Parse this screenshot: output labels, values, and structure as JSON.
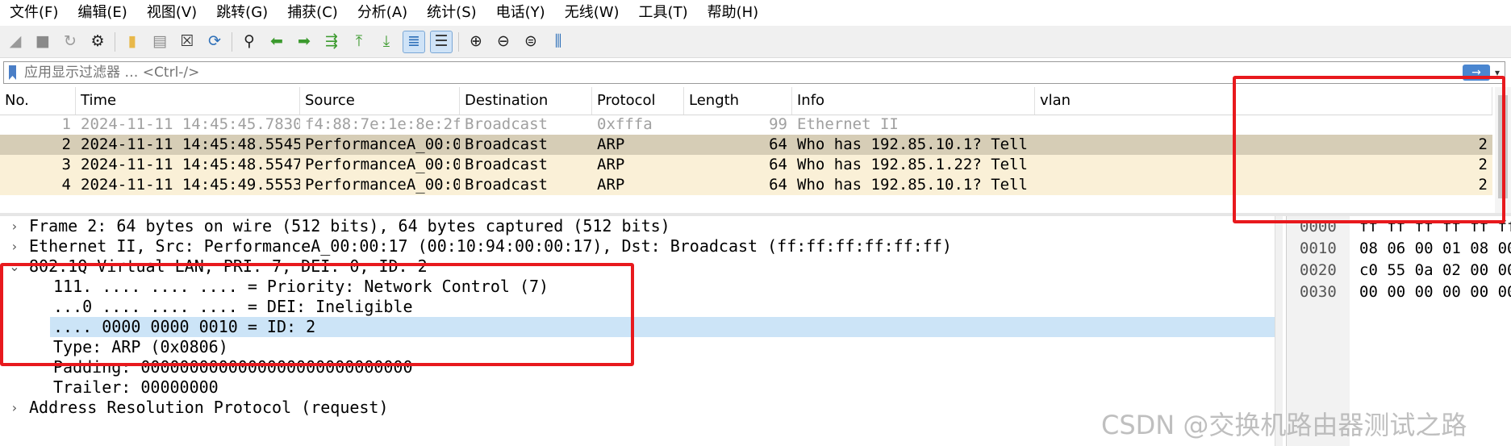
{
  "menu": [
    "文件(F)",
    "编辑(E)",
    "视图(V)",
    "跳转(G)",
    "捕获(C)",
    "分析(A)",
    "统计(S)",
    "电话(Y)",
    "无线(W)",
    "工具(T)",
    "帮助(H)"
  ],
  "toolbar": {
    "icons": [
      {
        "name": "shark-fin-start-icon",
        "glyph": "◢",
        "color": "#9a9a9a"
      },
      {
        "name": "stop-capture-icon",
        "glyph": "■",
        "color": "#8a8a8a"
      },
      {
        "name": "restart-capture-icon",
        "glyph": "↻",
        "color": "#9a9a9a"
      },
      {
        "name": "capture-options-icon",
        "glyph": "⚙",
        "color": "#222222"
      },
      {
        "sep": true
      },
      {
        "name": "open-file-icon",
        "glyph": "▮",
        "color": "#e8b84a"
      },
      {
        "name": "save-file-icon",
        "glyph": "▤",
        "color": "#8a8a8a"
      },
      {
        "name": "close-file-icon",
        "glyph": "☒",
        "color": "#333333"
      },
      {
        "name": "reload-file-icon",
        "glyph": "⟳",
        "color": "#2d6fb8"
      },
      {
        "sep": true
      },
      {
        "name": "find-packet-icon",
        "glyph": "⚲",
        "color": "#222222"
      },
      {
        "name": "go-back-icon",
        "glyph": "⬅",
        "color": "#3c9a2e"
      },
      {
        "name": "go-forward-icon",
        "glyph": "➡",
        "color": "#3c9a2e"
      },
      {
        "name": "go-to-packet-icon",
        "glyph": "⇶",
        "color": "#3c9a2e"
      },
      {
        "name": "go-first-icon",
        "glyph": "⤒",
        "color": "#3c9a2e"
      },
      {
        "name": "go-last-icon",
        "glyph": "⤓",
        "color": "#3c9a2e"
      },
      {
        "name": "auto-scroll-icon",
        "glyph": "≣",
        "color": "#2d6fb8",
        "selected": true
      },
      {
        "name": "colorize-icon",
        "glyph": "☰",
        "color": "#333333",
        "selected": true
      },
      {
        "sep": true
      },
      {
        "name": "zoom-in-icon",
        "glyph": "⊕",
        "color": "#222222"
      },
      {
        "name": "zoom-out-icon",
        "glyph": "⊖",
        "color": "#222222"
      },
      {
        "name": "zoom-normal-icon",
        "glyph": "⊜",
        "color": "#222222"
      },
      {
        "name": "resize-columns-icon",
        "glyph": "⫼",
        "color": "#2d6fb8"
      }
    ]
  },
  "filter": {
    "placeholder": "应用显示过滤器 … <Ctrl-/>",
    "apply_glyph": "→",
    "dropdown_glyph": "▾"
  },
  "packet_list": {
    "columns": [
      "No.",
      "Time",
      "Source",
      "Destination",
      "Protocol",
      "Length",
      "Info",
      "vlan"
    ],
    "rows": [
      {
        "no": "1",
        "time": "2024-11-11 14:45:45.78300…",
        "source": "f4:88:7e:1e:8e:2f",
        "destination": "Broadcast",
        "protocol": "0xfffa",
        "length": "99",
        "info": "Ethernet II",
        "vlan": "",
        "style": "dim"
      },
      {
        "no": "2",
        "time": "2024-11-11 14:45:48.55453…",
        "source": "PerformanceA_00:0…",
        "destination": "Broadcast",
        "protocol": "ARP",
        "length": "64",
        "info": "Who has 192.85.10.1? Tell 1…",
        "vlan": "2",
        "style": "selected"
      },
      {
        "no": "3",
        "time": "2024-11-11 14:45:48.55476…",
        "source": "PerformanceA_00:0…",
        "destination": "Broadcast",
        "protocol": "ARP",
        "length": "64",
        "info": "Who has 192.85.1.22? Tell 1…",
        "vlan": "2",
        "style": "arp"
      },
      {
        "no": "4",
        "time": "2024-11-11 14:45:49.55532…",
        "source": "PerformanceA_00:0…",
        "destination": "Broadcast",
        "protocol": "ARP",
        "length": "64",
        "info": "Who has 192.85.10.1? Tell 1…",
        "vlan": "2",
        "style": "arp"
      }
    ]
  },
  "details": [
    {
      "text": "Frame 2: 64 bytes on wire (512 bits), 64 bytes captured (512 bits)",
      "indent": 0,
      "toggle": "collapsed"
    },
    {
      "text": "Ethernet II, Src: PerformanceA_00:00:17 (00:10:94:00:00:17), Dst: Broadcast (ff:ff:ff:ff:ff:ff)",
      "indent": 0,
      "toggle": "collapsed"
    },
    {
      "text": "802.1Q Virtual LAN, PRI: 7, DEI: 0, ID: 2",
      "indent": 0,
      "toggle": "expanded"
    },
    {
      "text": "111. .... .... .... = Priority: Network Control (7)",
      "indent": 1,
      "toggle": "none"
    },
    {
      "text": "...0 .... .... .... = DEI: Ineligible",
      "indent": 1,
      "toggle": "none"
    },
    {
      "text": ".... 0000 0000 0010 = ID: 2",
      "indent": 1,
      "toggle": "none",
      "selected": true
    },
    {
      "text": "Type: ARP (0x0806)",
      "indent": 1,
      "toggle": "none"
    },
    {
      "text": "Padding: 0000000000000000000000000000",
      "indent": 1,
      "toggle": "none"
    },
    {
      "text": "Trailer: 00000000",
      "indent": 1,
      "toggle": "none"
    },
    {
      "text": "Address Resolution Protocol (request)",
      "indent": 0,
      "toggle": "collapsed"
    }
  ],
  "bytes": [
    {
      "offset": "0000",
      "hex": "ff ff ff ff ff ff"
    },
    {
      "offset": "0010",
      "hex": "08 06 00 01 08 00"
    },
    {
      "offset": "0020",
      "hex": "c0 55 0a 02 00 00"
    },
    {
      "offset": "0030",
      "hex": "00 00 00 00 00 00"
    }
  ],
  "watermark": "CSDN @交换机路由器测试之路",
  "colors": {
    "selected_row": "#d6cdb6",
    "arp_row": "#faf0d7",
    "dim_text": "#a0a0a0",
    "annotation": "#e8191d",
    "detail_selected": "#cce4f7"
  }
}
